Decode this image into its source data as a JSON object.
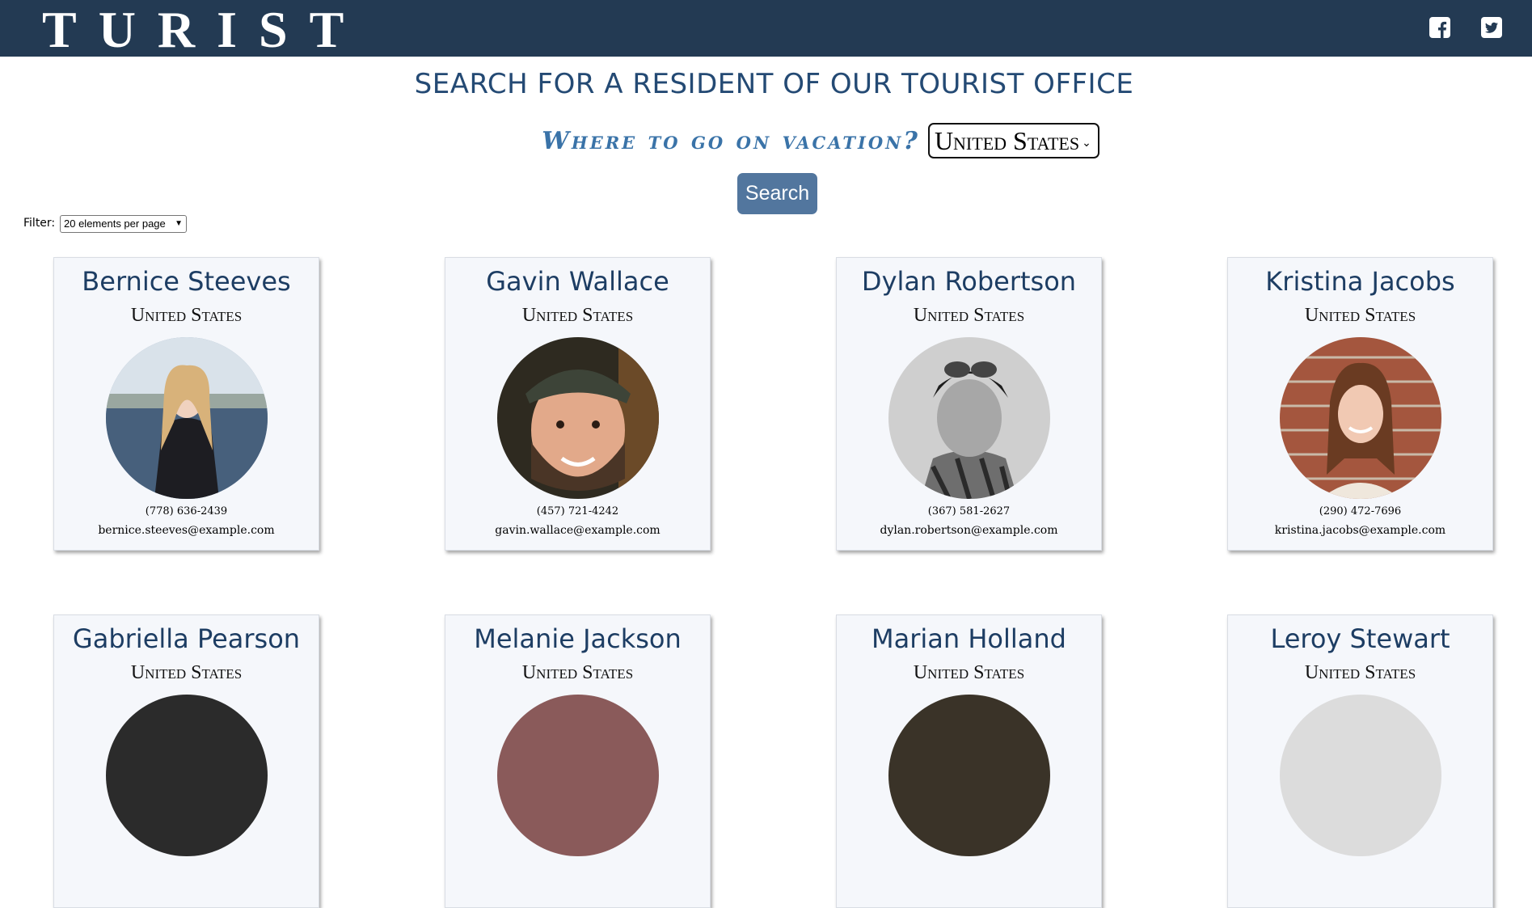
{
  "header": {
    "brand": "TURIST",
    "social": [
      {
        "icon": "facebook-icon"
      },
      {
        "icon": "twitter-icon"
      }
    ]
  },
  "main": {
    "title": "SEARCH FOR A RESIDENT OF OUR TOURIST OFFICE",
    "vacation_label": "Where to go on vacation?",
    "country_select": {
      "value": "United States",
      "icon": "chevron-down-icon"
    },
    "search_button": "Search",
    "filter": {
      "label": "Filter:",
      "value": "20 elements per page",
      "icon": "chevron-down-icon"
    }
  },
  "residents": [
    {
      "name": "Bernice Steeves",
      "country": "United States",
      "phone": "(778) 636-2439",
      "email": "bernice.steeves@example.com"
    },
    {
      "name": "Gavin Wallace",
      "country": "United States",
      "phone": "(457) 721-4242",
      "email": "gavin.wallace@example.com"
    },
    {
      "name": "Dylan Robertson",
      "country": "United States",
      "phone": "(367) 581-2627",
      "email": "dylan.robertson@example.com"
    },
    {
      "name": "Kristina Jacobs",
      "country": "United States",
      "phone": "(290) 472-7696",
      "email": "kristina.jacobs@example.com"
    },
    {
      "name": "Gabriella Pearson",
      "country": "United States"
    },
    {
      "name": "Melanie Jackson",
      "country": "United States"
    },
    {
      "name": "Marian Holland",
      "country": "United States"
    },
    {
      "name": "Leroy Stewart",
      "country": "United States"
    }
  ],
  "colors": {
    "header_bg": "#233a53",
    "title": "#244a74",
    "accent_button": "#52769e",
    "card_name": "#1d3d63"
  }
}
